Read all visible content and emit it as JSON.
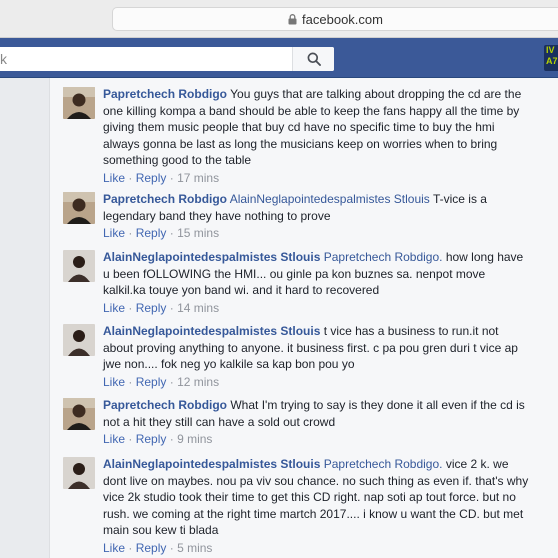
{
  "browser": {
    "url": "facebook.com"
  },
  "header": {
    "search_placeholder": "k",
    "corner_badge_lines": [
      "IV",
      "A7"
    ]
  },
  "comments": [
    {
      "author": "Papretchech Robdigo",
      "mention": "",
      "text": "You guys that are talking about dropping the cd are the one killing kompa a band should be able to keep the fans happy all the time by giving them music people that buy cd have no specific time to buy the hmi always gonna be last as long the musicians keep on worries when to bring something good to the table",
      "like": "Like",
      "reply": "Reply",
      "sep": "·",
      "time": "17 mins"
    },
    {
      "author": "Papretchech Robdigo",
      "mention": "AlainNeglapointedespalmistes Stlouis",
      "text": "T-vice is a legendary band they have nothing to prove",
      "like": "Like",
      "reply": "Reply",
      "sep": "·",
      "time": "15 mins"
    },
    {
      "author": "AlainNeglapointedespalmistes Stlouis",
      "mention": "Papretchech Robdigo.",
      "text": "how long have u been fOLLOWING the HMI... ou ginle pa kon buznes sa. nenpot move kalkil.ka touye yon band wi. and it hard to recovered",
      "like": "Like",
      "reply": "Reply",
      "sep": "·",
      "time": "14 mins"
    },
    {
      "author": "AlainNeglapointedespalmistes Stlouis",
      "mention": "",
      "text": "t vice has a business to run.it not about proving anything to anyone. it business first. c pa pou gren duri t vice ap jwe non.... fok neg yo kalkile sa kap bon pou yo",
      "like": "Like",
      "reply": "Reply",
      "sep": "·",
      "time": "12 mins"
    },
    {
      "author": "Papretchech Robdigo",
      "mention": "",
      "text": "What I'm trying to say is they done it all even if the cd is not a hit they still can have a sold out crowd",
      "like": "Like",
      "reply": "Reply",
      "sep": "·",
      "time": "9 mins"
    },
    {
      "author": "AlainNeglapointedespalmistes Stlouis",
      "mention": "Papretchech Robdigo.",
      "text": "vice 2 k. we dont live on maybes. nou pa viv sou chance. no such thing as even if. that's why vice 2k studio took their time to get this CD right. nap soti ap tout force. but no rush. we coming at the right time martch 2017.... i know u want the CD. but met main sou kew ti blada",
      "like": "Like",
      "reply": "Reply",
      "sep": "·",
      "time": "5 mins"
    }
  ],
  "colors": {
    "fb_blue": "#3b5998",
    "link": "#365899",
    "action_link": "#4267b2",
    "meta": "#90949c"
  }
}
